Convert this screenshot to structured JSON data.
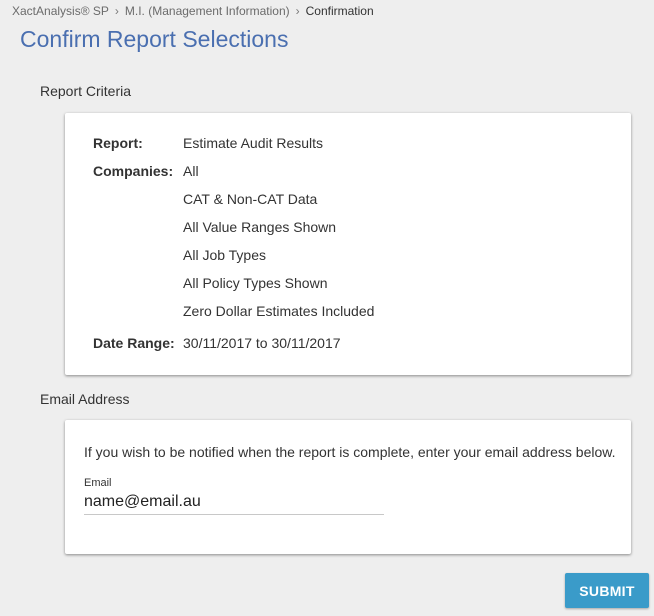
{
  "breadcrumb": {
    "items": [
      "XactAnalysis® SP",
      "M.I. (Management Information)"
    ],
    "separator": "›",
    "current": "Confirmation"
  },
  "page": {
    "title": "Confirm Report Selections"
  },
  "criteria": {
    "section_label": "Report Criteria",
    "report_key": "Report:",
    "report_value": "Estimate Audit Results",
    "companies_key": "Companies:",
    "companies_values": [
      "All",
      "CAT & Non-CAT Data",
      "All Value Ranges Shown",
      "All Job Types",
      "All Policy Types Shown",
      "Zero Dollar Estimates Included"
    ],
    "date_key": "Date Range:",
    "date_value": "30/11/2017 to 30/11/2017"
  },
  "email": {
    "section_label": "Email Address",
    "intro": "If you wish to be notified when the report is complete, enter your email address below.",
    "field_label": "Email",
    "field_value": "name@email.au"
  },
  "actions": {
    "submit_label": "SUBMIT"
  },
  "colors": {
    "title": "#4a6fb0",
    "submit_bg": "#3a9bc9",
    "page_bg": "#eeeeee"
  }
}
